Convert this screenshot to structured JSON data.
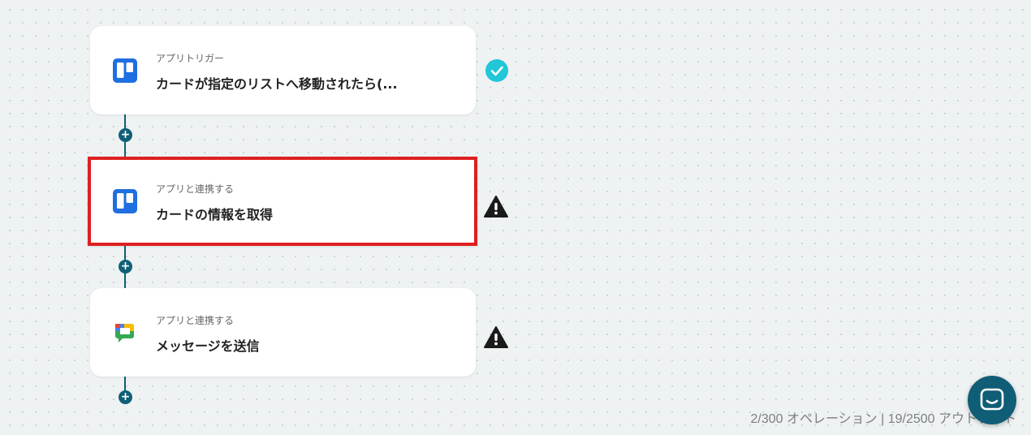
{
  "flow": {
    "steps": [
      {
        "label": "アプリトリガー",
        "title": "カードが指定のリストへ移動されたら(...",
        "app_icon": "trello-icon",
        "status_icon": "check-circle-icon",
        "status_color": "#21c6d9"
      },
      {
        "label": "アプリと連携する",
        "title": "カードの情報を取得",
        "app_icon": "trello-icon",
        "status_icon": "warning-icon",
        "status_color": "#1a1a1a",
        "highlight_color": "#df1f1f"
      },
      {
        "label": "アプリと連携する",
        "title": "メッセージを送信",
        "app_icon": "google-chat-icon",
        "status_icon": "warning-icon",
        "status_color": "#1a1a1a"
      }
    ],
    "add_step_symbol": "+"
  },
  "footer": {
    "usage": "2/300 オペレーション | 19/2500 アウトプット"
  },
  "chat": {
    "icon": "chat-icon",
    "color": "#105d76"
  },
  "colors": {
    "accent": "#0f5f78",
    "trello_blue": "#1f6fe0"
  }
}
